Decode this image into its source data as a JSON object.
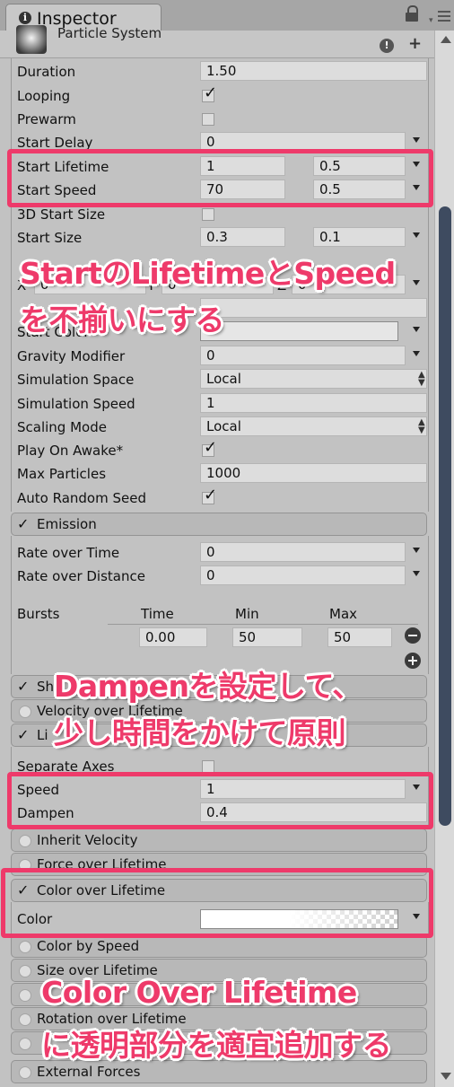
{
  "tab": {
    "title": "Inspector"
  },
  "component": {
    "title": "Particle System"
  },
  "main_rows": [
    {
      "label": "Duration",
      "value": "1.50"
    },
    {
      "label": "Looping"
    },
    {
      "label": "Prewarm"
    },
    {
      "label": "Start Delay",
      "value": "0"
    },
    {
      "label": "Start Lifetime",
      "value": "1",
      "value2": "0.5"
    },
    {
      "label": "Start Speed",
      "value": "70",
      "value2": "0.5"
    },
    {
      "label": "3D Start Size"
    },
    {
      "label": "Start Size",
      "value": "0.3",
      "value2": "0.1"
    },
    {
      "label": "X",
      "value": "0",
      "label_y": "Y",
      "value_y": "0",
      "label_z": "Z",
      "value_z": "0"
    },
    {
      "label": "Start Color"
    },
    {
      "label": "Gravity Modifier",
      "value": "0"
    },
    {
      "label": "Simulation Space",
      "value": "Local"
    },
    {
      "label": "Simulation Speed",
      "value": "1"
    },
    {
      "label": "Scaling Mode",
      "value": "Local"
    },
    {
      "label": "Play On Awake*"
    },
    {
      "label": "Max Particles",
      "value": "1000"
    },
    {
      "label": "Auto Random Seed"
    }
  ],
  "emission": {
    "title": "Emission",
    "rate_over_time": {
      "label": "Rate over Time",
      "value": "0"
    },
    "rate_over_distance": {
      "label": "Rate over Distance",
      "value": "0"
    },
    "bursts": {
      "label": "Bursts",
      "headers": [
        "Time",
        "Min",
        "Max"
      ],
      "values": [
        "0.00",
        "50",
        "50"
      ]
    }
  },
  "sections": {
    "shape": "Sh",
    "velocity": "Velocity over Lifetime",
    "limit": "Li",
    "separate_axes": "Separate Axes",
    "speed": {
      "label": "Speed",
      "value": "1"
    },
    "dampen": {
      "label": "Dampen",
      "value": "0.4"
    },
    "inherit": "Inherit Velocity",
    "force": "Force over Lifetime",
    "color_over": "Color over Lifetime",
    "color": "Color",
    "color_by_speed": "Color by Speed",
    "size_over": "Size over Lifetime",
    "rotation_over": "Rotation over Lifetime",
    "external": "External Forces"
  },
  "annotations": {
    "a1_line1": "StartのLifetimeとSpeed",
    "a1_line2": "を不揃いにする",
    "a2_line1": "Dampenを設定して、",
    "a2_line2": "少し時間をかけて原則",
    "a3_line1": "Color Over Lifetime",
    "a3_line2": "に透明部分を適宜追加する"
  },
  "colors": {
    "highlight": "#ee3a6a",
    "scroll_thumb": "#3e4b60"
  }
}
